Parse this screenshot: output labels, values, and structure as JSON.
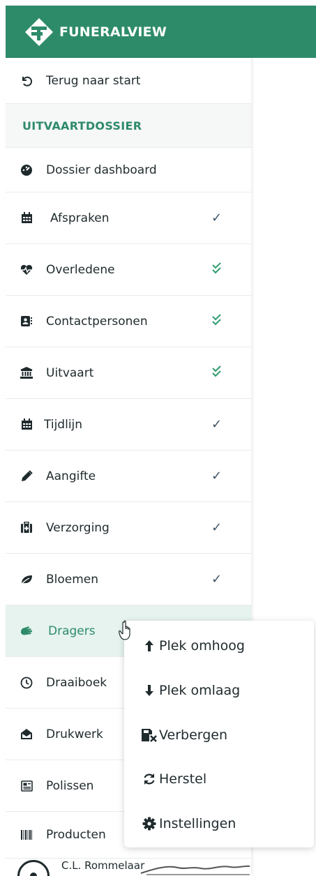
{
  "brand": {
    "name": "FUNERALVIEW",
    "color": "#2e8b6a"
  },
  "sidebar": {
    "back_label": "Terug naar start",
    "back_icon": "undo-icon",
    "section_title": "UITVAARTDOSSIER",
    "items": [
      {
        "label": "Dossier dashboard",
        "icon": "dashboard-icon",
        "status": "none"
      },
      {
        "label": "Afspraken",
        "icon": "calendar-icon",
        "status": "check"
      },
      {
        "label": "Overledene",
        "icon": "heartbeat-icon",
        "status": "double-check"
      },
      {
        "label": "Contactpersonen",
        "icon": "address-book-icon",
        "status": "double-check"
      },
      {
        "label": "Uitvaart",
        "icon": "landmark-icon",
        "status": "double-check"
      },
      {
        "label": "Tijdlijn",
        "icon": "calendar-icon",
        "status": "check"
      },
      {
        "label": "Aangifte",
        "icon": "pencil-icon",
        "status": "check"
      },
      {
        "label": "Verzorging",
        "icon": "first-aid-icon",
        "status": "check"
      },
      {
        "label": "Bloemen",
        "icon": "leaf-icon",
        "status": "check"
      },
      {
        "label": "Dragers",
        "icon": "hands-icon",
        "status": "active"
      },
      {
        "label": "Draaiboek",
        "icon": "clock-icon",
        "status": "none"
      },
      {
        "label": "Drukwerk",
        "icon": "envelope-open-icon",
        "status": "none"
      },
      {
        "label": "Polissen",
        "icon": "newspaper-icon",
        "status": "none"
      },
      {
        "label": "Producten",
        "icon": "barcode-icon",
        "status": "none"
      }
    ],
    "user_name": "C.L. Rommelaar"
  },
  "context_menu": {
    "items": [
      {
        "label": "Plek omhoog",
        "icon": "arrow-up-icon"
      },
      {
        "label": "Plek omlaag",
        "icon": "arrow-down-icon"
      },
      {
        "label": "Verbergen",
        "icon": "save-remove-icon"
      },
      {
        "label": "Herstel",
        "icon": "sync-icon"
      },
      {
        "label": "Instellingen",
        "icon": "gear-icon"
      }
    ]
  }
}
